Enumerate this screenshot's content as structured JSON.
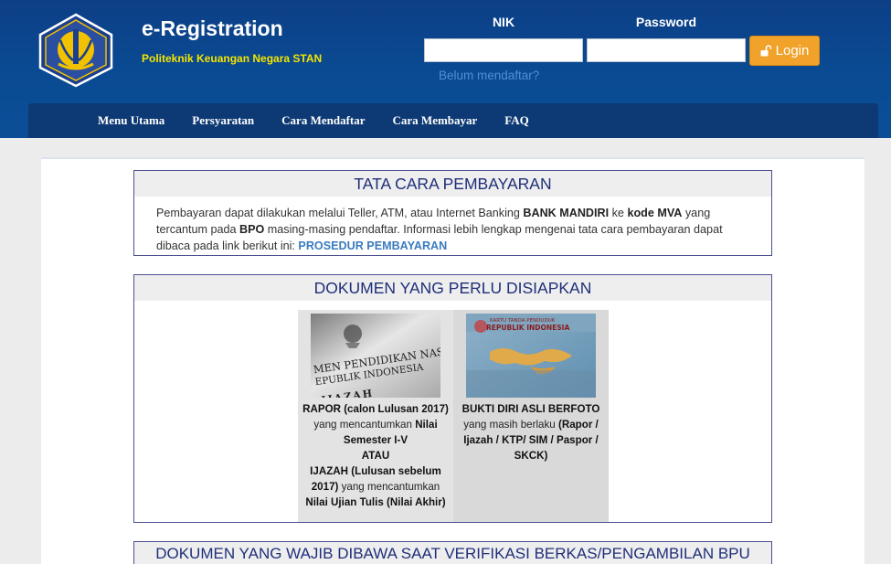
{
  "header": {
    "title": "e-Registration",
    "subtitle": "Politeknik Keuangan Negara STAN",
    "logo": "kemenkeu-logo"
  },
  "login": {
    "nik_label": "NIK",
    "password_label": "Password",
    "nik_value": "",
    "password_value": "",
    "login_button": "Login",
    "login_icon": "unlock-icon",
    "register_link": "Belum mendaftar?"
  },
  "nav": {
    "items": [
      "Menu Utama",
      "Persyaratan",
      "Cara Mendaftar",
      "Cara Membayar",
      "FAQ"
    ]
  },
  "payment": {
    "title": "TATA CARA PEMBAYARAN",
    "text_1": "Pembayaran dapat dilakukan melalui Teller, ATM, atau Internet Banking ",
    "bank": "BANK MANDIRI",
    "text_2": " ke ",
    "code": "kode MVA",
    "text_3": " yang tercantum pada ",
    "bpo": "BPO",
    "text_4": " masing-masing pendaftar. Informasi lebih lengkap mengenai tata cara pembayaran dapat dibaca pada link berikut ini: ",
    "link": "PROSEDUR PEMBAYARAN"
  },
  "documents": {
    "title": "DOKUMEN YANG PERLU DISIAPKAN",
    "card1": {
      "img_line1": "MEN PENDIDIKAN NASIONAL",
      "img_line2": "EPUBLIK INDONESIA",
      "img_line3": "IJAZAH",
      "b1": "RAPOR (calon Lulusan 2017)",
      "t1": " yang mencantumkan ",
      "b2": "Nilai Semester I-V",
      "b3": "ATAU",
      "b4": "IJAZAH (Lulusan sebelum 2017)",
      "t2": " yang mencantumkan ",
      "b5": "Nilai Ujian Tulis (Nilai Akhir)"
    },
    "card2": {
      "img_line1": "KARTU TANDA PENDUDUK",
      "img_line2": "REPUBLIK INDONESIA",
      "b1": "BUKTI DIRI ASLI BERFOTO",
      "t1": " yang masih berlaku ",
      "b2": "(Rapor / Ijazah / KTP/ SIM / Paspor / SKCK)"
    }
  },
  "verification": {
    "title": "DOKUMEN YANG WAJIB DIBAWA SAAT VERIFIKASI BERKAS/PENGAMBILAN BPU"
  }
}
